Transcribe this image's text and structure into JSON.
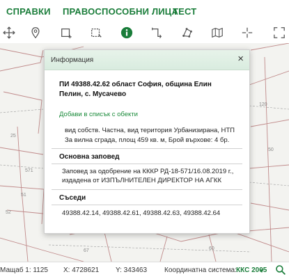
{
  "menu": {
    "items": [
      {
        "label": "СПРАВКИ"
      },
      {
        "label": "ПРАВОСПОСОБНИ ЛИЦА"
      },
      {
        "label": "ТЕСТ"
      }
    ]
  },
  "toolbar": {
    "tools": [
      {
        "icon": "move-arrows-icon"
      },
      {
        "icon": "map-pin-icon"
      },
      {
        "icon": "draw-rectangle-icon"
      },
      {
        "icon": "select-rectangle-icon"
      },
      {
        "icon": "info-icon"
      },
      {
        "icon": "measure-length-icon"
      },
      {
        "icon": "draw-polygon-icon"
      },
      {
        "icon": "map-layers-icon"
      },
      {
        "icon": "crosshair-icon"
      },
      {
        "icon": "fullscreen-icon"
      }
    ],
    "active_color": "#1a7d3a"
  },
  "map": {
    "labels": [
      "25",
      "51",
      "52",
      "571",
      "50",
      "60",
      "120",
      "67"
    ]
  },
  "dialog": {
    "title": "Информация",
    "close": "×",
    "parcel_heading_1": "ПИ 49388.42.62 област София, община Елин",
    "parcel_heading_2": "Пелин, с. Мусачево",
    "add_link": "Добави в списък с обекти",
    "props_1": "вид собств. Частна, вид територия Урбанизирана, НТП",
    "props_2": "За вилна сграда, площ 459 кв. м, Брой върхове: 4 бр.",
    "order_heading": "Основна заповед",
    "order_1": "Заповед за одобрение на КККР РД-18-571/16.08.2019 г.,",
    "order_2": "издадена от ИЗПЪЛНИТЕЛЕН ДИРЕКТОР НА АГКК",
    "neighbors_heading": "Съседи",
    "neighbors": "49388.42.14, 49388.42.61, 49388.42.63, 49388.42.64"
  },
  "status": {
    "scale": "Мащаб 1:  1125",
    "x": "X:   4728621",
    "y": "Y:   343463",
    "crs_label": "Координатна система:",
    "crs_value": "ККС 2005",
    "dropdown": "▼"
  },
  "colors": {
    "brand_green": "#1a7d3a",
    "map_line": "#c08a8a"
  }
}
